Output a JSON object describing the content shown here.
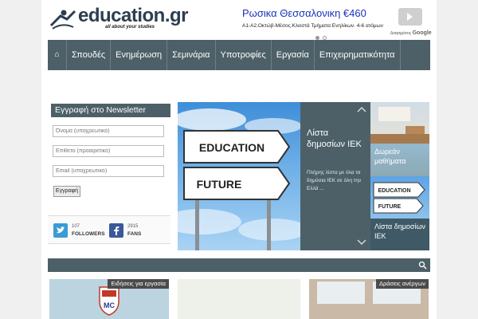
{
  "header": {
    "logo_text": "education.gr",
    "logo_tagline": "all about your studies"
  },
  "ad": {
    "title": "Ρωσικα Θεσσαλονικη €460",
    "text": "Α1-Α2.Οκτώβ-Μέσος.Κλειστά Τμήματα Ενηλίκων. 4-6 ατόμων",
    "brand_prefix": "Διαφημίσεις",
    "brand_name": "Google"
  },
  "nav": {
    "items": [
      "Σπουδές",
      "Ενημέρωση",
      "Σεμινάρια",
      "Υποτροφίες",
      "Εργασία",
      "Επιχειρηματικότητα"
    ]
  },
  "newsletter": {
    "title": "Εγγραφή στο Newsletter",
    "fields": [
      "Όνομα (υποχρεωτικό)",
      "Επίθετο (προαιρετικό)",
      "Email (υποχρεωτικό)"
    ],
    "submit_label": "Εγγραφή"
  },
  "social": {
    "twitter_count": "107",
    "twitter_label": "FOLLOWERS",
    "facebook_count": "2915",
    "facebook_label": "FANS"
  },
  "slider": {
    "sign_top": "EDUCATION",
    "sign_bottom": "FUTURE",
    "caption_title": "Λίστα δημοσίων ΙΕΚ",
    "caption_text": "Πλήρης λίστα με όλα τα δημόσια ΙΕΚ σε όλη την Ελλά ...",
    "thumbs": [
      {
        "label": "Δωρεάν μαθήματα"
      },
      {
        "label": "Λίστα δημοσίων ΙΕΚ",
        "sign_top": "EDUCATION",
        "sign_bottom": "FUTURE"
      }
    ]
  },
  "cards": [
    {
      "tag": "Ειδήσεις για εργασία",
      "logo_text": "MC"
    },
    {
      "tag": ""
    },
    {
      "tag": "Δράσεις ανέργων"
    }
  ],
  "colors": {
    "nav_bg": "#4d6068",
    "accent_blue": "#1a33b8",
    "twitter": "#3b9bd6",
    "facebook": "#3b5998"
  }
}
